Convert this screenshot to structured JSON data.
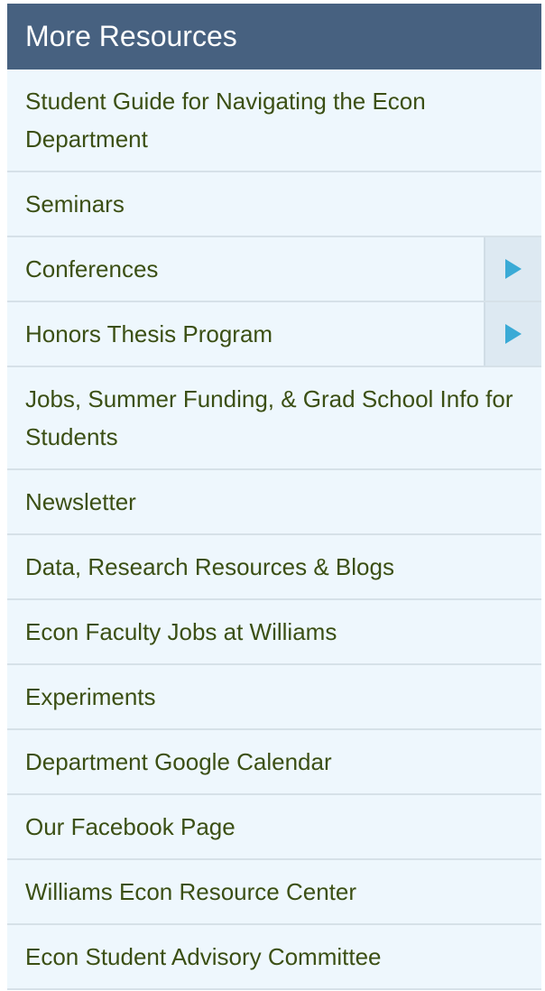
{
  "header": {
    "title": "More Resources"
  },
  "menu": {
    "items": [
      {
        "label": "Student Guide for Navigating the Econ Department",
        "has_submenu": false
      },
      {
        "label": "Seminars",
        "has_submenu": false
      },
      {
        "label": "Conferences",
        "has_submenu": true
      },
      {
        "label": "Honors Thesis Program",
        "has_submenu": true
      },
      {
        "label": "Jobs, Summer Funding, & Grad School Info for Students",
        "has_submenu": false
      },
      {
        "label": "Newsletter",
        "has_submenu": false
      },
      {
        "label": "Data, Research Resources & Blogs",
        "has_submenu": false
      },
      {
        "label": "Econ Faculty Jobs at Williams",
        "has_submenu": false
      },
      {
        "label": "Experiments",
        "has_submenu": false
      },
      {
        "label": "Department Google Calendar",
        "has_submenu": false
      },
      {
        "label": "Our Facebook Page",
        "has_submenu": false
      },
      {
        "label": "Williams Econ Resource Center",
        "has_submenu": false
      },
      {
        "label": "Econ Student Advisory Committee",
        "has_submenu": false
      }
    ]
  },
  "icons": {
    "expand": "triangle-right-icon"
  },
  "colors": {
    "header_bg": "#476180",
    "menu_bg": "#eef7fd",
    "link_text": "#3b4f14",
    "arrow": "#3aaad6",
    "expander_bg": "#dde9f2"
  }
}
